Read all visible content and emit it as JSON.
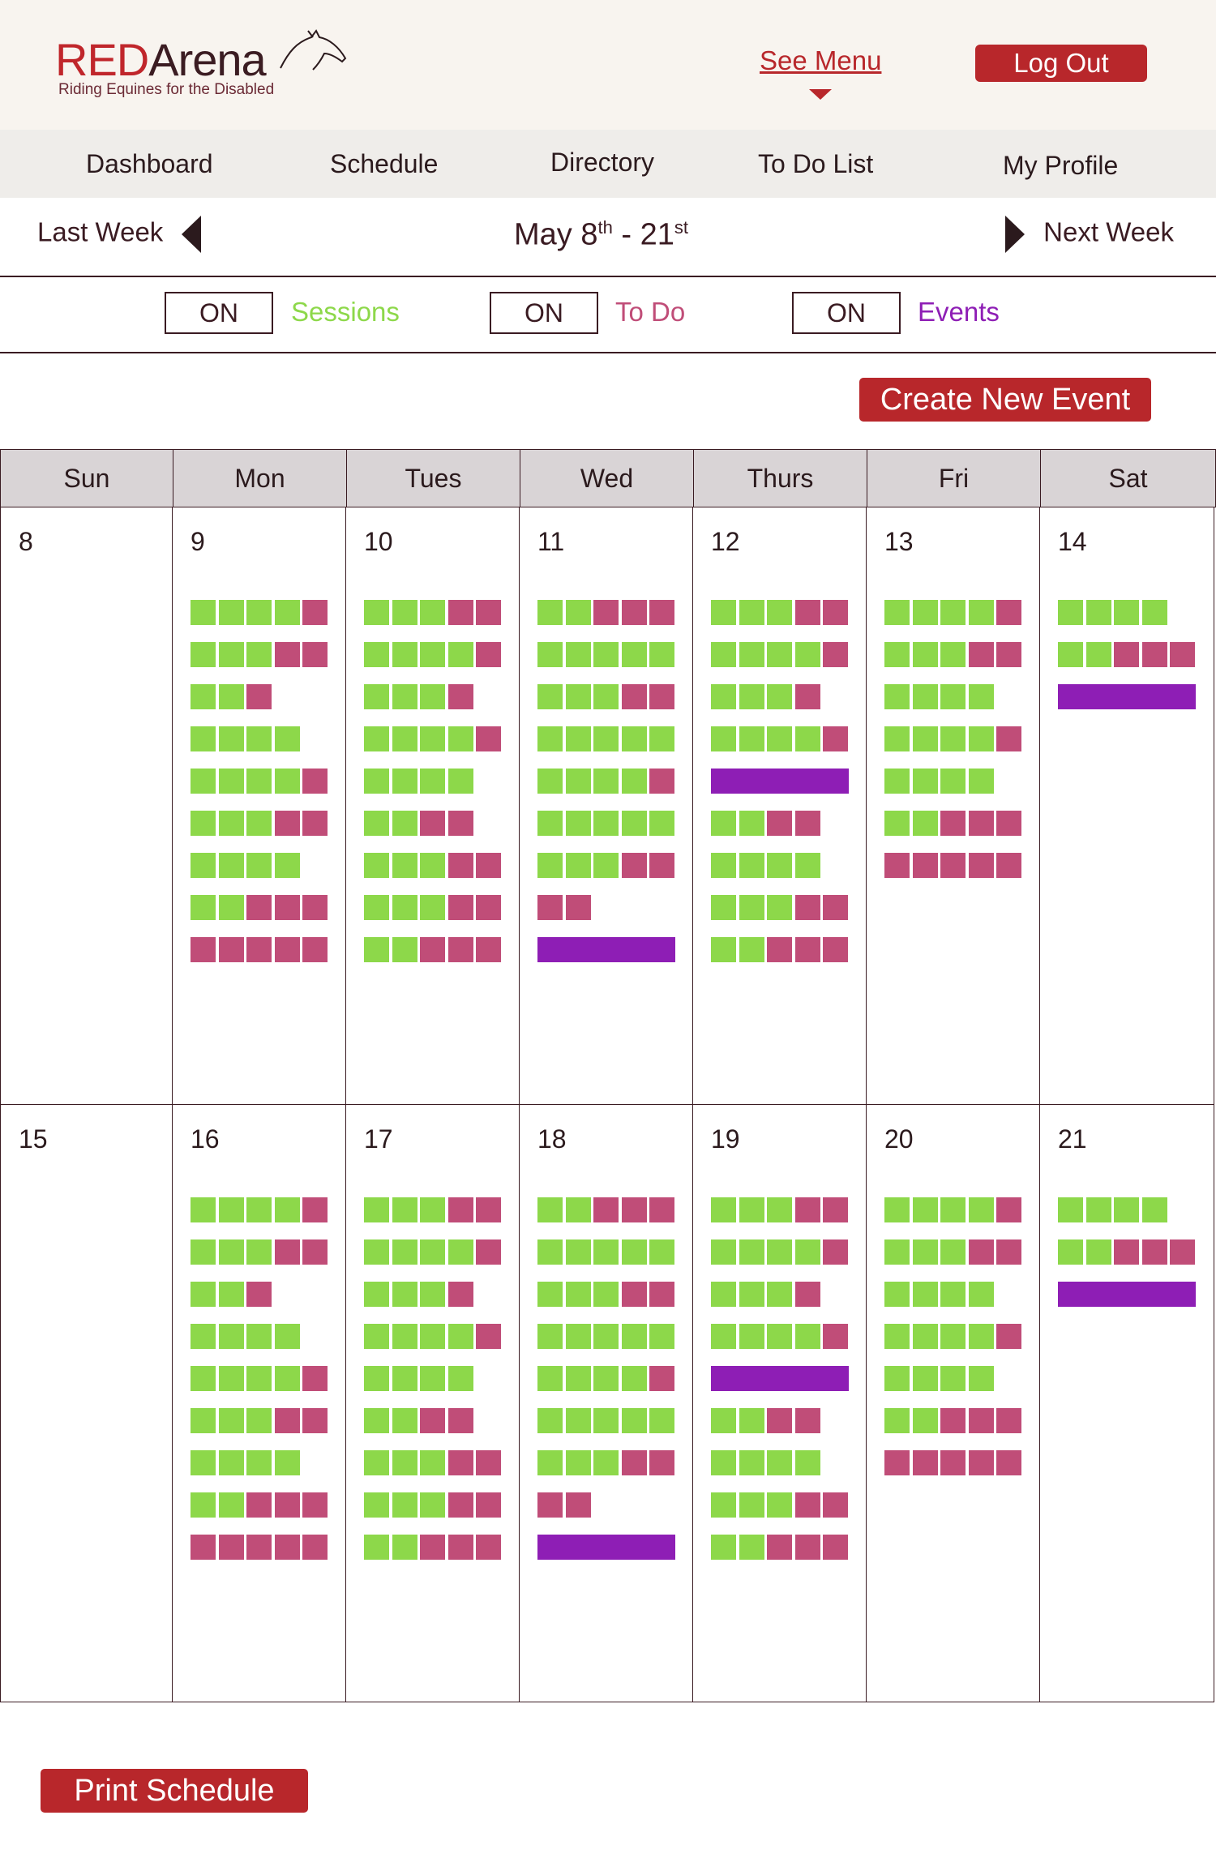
{
  "header": {
    "logo_red": "RED",
    "logo_arena": "Arena",
    "logo_tagline": "Riding Equines for the Disabled",
    "see_menu": "See Menu",
    "logout": "Log Out"
  },
  "nav": {
    "items": [
      "Dashboard",
      "Schedule",
      "Directory",
      "To Do List",
      "My Profile"
    ]
  },
  "week": {
    "prev": "Last Week",
    "next": "Next Week",
    "range_start": "May 8",
    "range_start_sup": "th",
    "range_sep": " - ",
    "range_end": "21",
    "range_end_sup": "st"
  },
  "toggles": [
    {
      "state": "ON",
      "label": "Sessions",
      "color": "#8dd84a"
    },
    {
      "state": "ON",
      "label": "To Do",
      "color": "#c04d78"
    },
    {
      "state": "ON",
      "label": "Events",
      "color": "#8e1eb5"
    }
  ],
  "create_event": "Create New Event",
  "print_schedule": "Print Schedule",
  "colors": {
    "accent": "#b8272b",
    "session": "#8dd84a",
    "todo": "#c04d78",
    "event": "#8e1eb5",
    "header_bg": "#f8f4ef"
  },
  "calendar": {
    "day_headers": [
      "Sun",
      "Mon",
      "Tues",
      "Wed",
      "Thurs",
      "Fri",
      "Sat"
    ],
    "weeks": [
      {
        "days": [
          {
            "num": "8",
            "rows": []
          },
          {
            "num": "9",
            "rows": [
              "ggggp",
              "gggpp",
              "ggp",
              "gggg",
              "ggggp",
              "gggpp",
              "gggg",
              "ggppp",
              "ppppp"
            ]
          },
          {
            "num": "10",
            "rows": [
              "gggpp",
              "ggggp",
              "gggp",
              "ggggp",
              "gggg",
              "ggpp",
              "gggpp",
              "gggpp",
              "ggppp"
            ]
          },
          {
            "num": "11",
            "rows": [
              "ggppp",
              "ggggg",
              "gggpp",
              "ggggg",
              "ggggp",
              "ggggg",
              "gggpp",
              "pp",
              "E"
            ]
          },
          {
            "num": "12",
            "rows": [
              "gggpp",
              "ggggp",
              "gggp",
              "ggggp",
              "E",
              "ggpp",
              "gggg",
              "gggpp",
              "ggppp"
            ]
          },
          {
            "num": "13",
            "rows": [
              "ggggp",
              "gggpp",
              "gggg",
              "ggggp",
              "gggg",
              "ggppp",
              "ppppp"
            ]
          },
          {
            "num": "14",
            "rows": [
              "gggg",
              "ggppp",
              "E"
            ]
          }
        ]
      },
      {
        "days": [
          {
            "num": "15",
            "rows": []
          },
          {
            "num": "16",
            "rows": [
              "ggggp",
              "gggpp",
              "ggp",
              "gggg",
              "ggggp",
              "gggpp",
              "gggg",
              "ggppp",
              "ppppp"
            ]
          },
          {
            "num": "17",
            "rows": [
              "gggpp",
              "ggggp",
              "gggp",
              "ggggp",
              "gggg",
              "ggpp",
              "gggpp",
              "gggpp",
              "ggppp"
            ]
          },
          {
            "num": "18",
            "rows": [
              "ggppp",
              "ggggg",
              "gggpp",
              "ggggg",
              "ggggp",
              "ggggg",
              "gggpp",
              "pp",
              "E"
            ]
          },
          {
            "num": "19",
            "rows": [
              "gggpp",
              "ggggp",
              "gggp",
              "ggggp",
              "E",
              "ggpp",
              "gggg",
              "gggpp",
              "ggppp"
            ]
          },
          {
            "num": "20",
            "rows": [
              "ggggp",
              "gggpp",
              "gggg",
              "ggggp",
              "gggg",
              "ggppp",
              "ppppp"
            ]
          },
          {
            "num": "21",
            "rows": [
              "gggg",
              "ggppp",
              "E"
            ]
          }
        ]
      }
    ]
  }
}
